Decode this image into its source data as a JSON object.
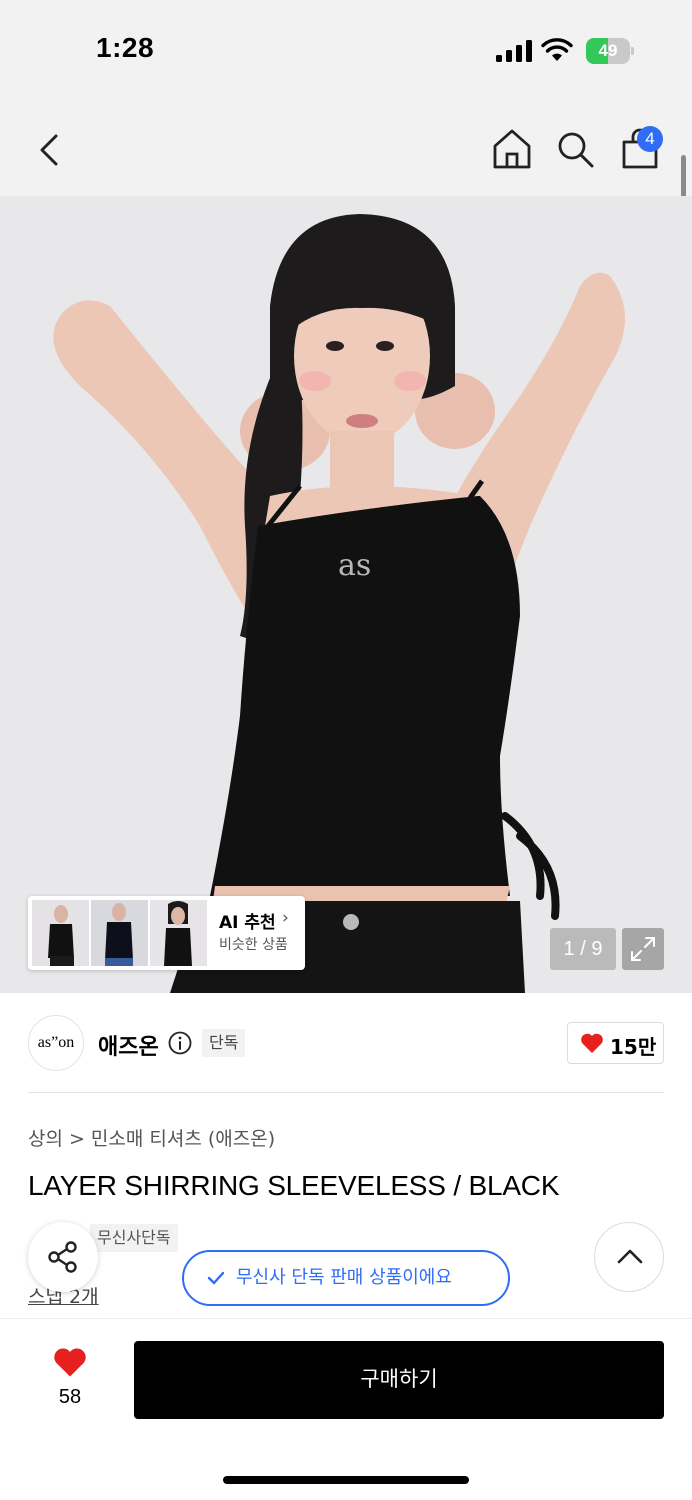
{
  "status_bar": {
    "time": "1:28",
    "battery_level": "49",
    "battery_fill_fraction": 0.49
  },
  "nav": {
    "cart_count": "4"
  },
  "gallery": {
    "print_text": "as",
    "counter": "1 / 9",
    "ai_recommend": {
      "title": "AI 추천",
      "subtitle": "비슷한 상품"
    }
  },
  "brand": {
    "logo_text": "as”on",
    "name": "애즈온",
    "tag": "단독",
    "likes": "15만"
  },
  "product": {
    "breadcrumb": [
      "상의",
      ">",
      "민소매 티셔츠 (애즈온)"
    ],
    "title": "LAYER SHIRRING SLEEVELESS / BLACK",
    "tags": [
      "무신사단독"
    ],
    "snap_link": "스냅 2개"
  },
  "toast": {
    "text": "무신사 단독 판매 상품이에요"
  },
  "bottom": {
    "wish_count": "58",
    "buy_label": "구매하기"
  },
  "colors": {
    "accent_blue": "#2f6df6",
    "heart_red": "#e5201f",
    "buy_button": "#000000"
  }
}
